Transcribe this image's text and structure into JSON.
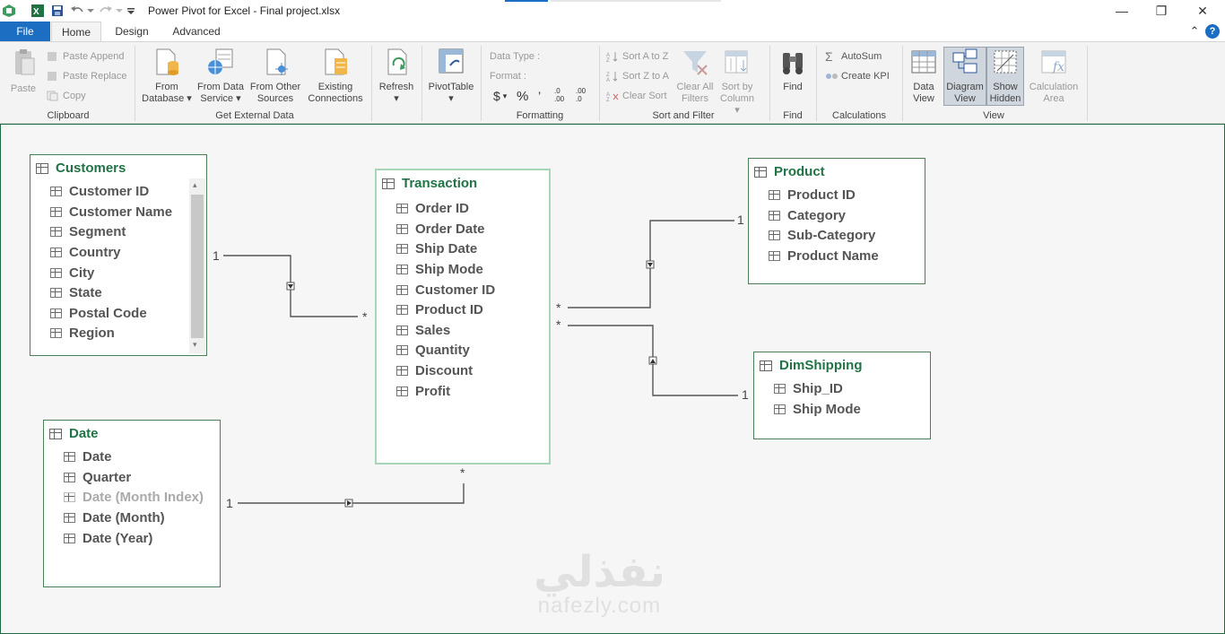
{
  "window": {
    "title": "Power Pivot for Excel - Final project.xlsx",
    "controls": {
      "minimize": "—",
      "restore": "❐",
      "close": "✕"
    }
  },
  "tabs": {
    "file": "File",
    "home": "Home",
    "design": "Design",
    "advanced": "Advanced",
    "collapse": "⌃",
    "help": "?"
  },
  "ribbon": {
    "clipboard": {
      "label": "Clipboard",
      "paste": "Paste",
      "paste_append": "Paste Append",
      "paste_replace": "Paste Replace",
      "copy": "Copy"
    },
    "external": {
      "label": "Get External Data",
      "from_database_1": "From",
      "from_database_2": "Database",
      "from_data_service_1": "From Data",
      "from_data_service_2": "Service",
      "from_other_sources_1": "From Other",
      "from_other_sources_2": "Sources",
      "existing_1": "Existing",
      "existing_2": "Connections"
    },
    "refresh": "Refresh",
    "pivottable": "PivotTable",
    "formatting": {
      "label": "Formatting",
      "data_type": "Data Type :",
      "format": "Format :",
      "currency": "$",
      "percent": "%",
      "comma": "’",
      "inc_dec": ".0 .00",
      "dec_dec": ".00 .0"
    },
    "sort_filter": {
      "label": "Sort and Filter",
      "sort_az": "Sort A to Z",
      "sort_za": "Sort Z to A",
      "clear_sort": "Clear Sort",
      "clear_filters_1": "Clear All",
      "clear_filters_2": "Filters",
      "sort_by_col_1": "Sort by",
      "sort_by_col_2": "Column"
    },
    "find": {
      "label": "Find",
      "button": "Find"
    },
    "calculations": {
      "label": "Calculations",
      "autosum": "AutoSum",
      "create_kpi": "Create KPI"
    },
    "view": {
      "label": "View",
      "data_view_1": "Data",
      "data_view_2": "View",
      "diagram_view_1": "Diagram",
      "diagram_view_2": "View",
      "show_hidden_1": "Show",
      "show_hidden_2": "Hidden",
      "calc_area_1": "Calculation",
      "calc_area_2": "Area"
    }
  },
  "diagram": {
    "customers": {
      "title": "Customers",
      "fields": [
        "Customer ID",
        "Customer Name",
        "Segment",
        "Country",
        "City",
        "State",
        "Postal Code",
        "Region"
      ]
    },
    "transaction": {
      "title": "Transaction",
      "fields": [
        "Order ID",
        "Order Date",
        "Ship Date",
        "Ship Mode",
        "Customer ID",
        "Product ID",
        "Sales",
        "Quantity",
        "Discount",
        "Profit"
      ]
    },
    "product": {
      "title": "Product",
      "fields": [
        "Product ID",
        "Category",
        "Sub-Category",
        "Product Name"
      ]
    },
    "dimshipping": {
      "title": "DimShipping",
      "fields": [
        "Ship_ID",
        "Ship Mode"
      ]
    },
    "date": {
      "title": "Date",
      "fields": [
        "Date",
        "Quarter",
        "Date (Month Index)",
        "Date (Month)",
        "Date (Year)"
      ],
      "hidden_field_index": 2
    },
    "relationship_labels": {
      "one": "1",
      "many": "*"
    }
  },
  "watermark": {
    "arabic": "نفذلي",
    "latin": "nafezly.com"
  },
  "colors": {
    "accent": "#1b6ec2",
    "table_title": "#217346",
    "table_border": "#4b7f58",
    "selected_border": "#a6d5b8"
  }
}
